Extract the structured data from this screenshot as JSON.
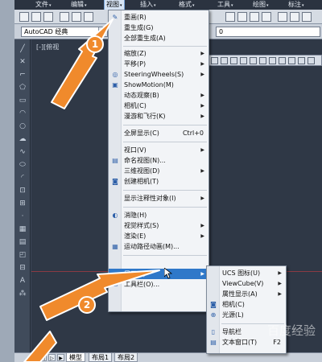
{
  "menubar": {
    "items": [
      "文件",
      "编辑",
      "视图",
      "插入",
      "格式",
      "工具",
      "绘图",
      "标注"
    ],
    "active_index": 2
  },
  "toolbar2": {
    "workspace": "AutoCAD 经典",
    "layer_value": "0"
  },
  "viewport_label": "[-][俯视",
  "view_menu": {
    "redraw": "重画(R)",
    "regen": "重生成(G)",
    "regen_all": "全部重生成(A)",
    "zoom": "缩放(Z)",
    "pan": "平移(P)",
    "steering": "SteeringWheels(S)",
    "showmotion": "ShowMotion(M)",
    "orbit": "动态观察(B)",
    "camera": "相机(C)",
    "walk_fly": "漫游和飞行(K)",
    "clean_screen": "全屏显示(C)",
    "clean_screen_shortcut": "Ctrl+0",
    "viewports": "视口(V)",
    "named_views": "命名视图(N)...",
    "views_3d": "三维视图(D)",
    "create_camera": "创建相机(T)",
    "annotation_objects": "显示注释性对象(I)",
    "hide": "消隐(H)",
    "visual_styles": "视觉样式(S)",
    "render": "渲染(E)",
    "motion_path": "运动路径动画(M)...",
    "display": "显示(L)",
    "toolbars": "工具栏(O)..."
  },
  "display_menu": {
    "ucs_icon": "UCS 图标(U)",
    "viewcube": "ViewCube(V)",
    "attribute_display": "属性显示(A)",
    "camera": "相机(C)",
    "lights": "光源(L)",
    "navbar": "导航栏",
    "text_window": "文本窗口(T)",
    "text_window_shortcut": "F2"
  },
  "tabs": {
    "model": "模型",
    "layout1": "布局1",
    "layout2": "布局2"
  },
  "badges": {
    "step1": "1",
    "step2": "2"
  },
  "watermark": "百度经验",
  "colors": {
    "highlight": "#2f78c9",
    "arrow": "#f08a2c"
  },
  "icons": {
    "menu_redraw": "pencil-icon",
    "menu_steering": "steering-wheel-icon",
    "menu_showmotion": "film-icon",
    "menu_hide": "hide-icon",
    "menu_motion_path": "motion-path-icon",
    "menu_toolbars": "toolbar-icon"
  }
}
